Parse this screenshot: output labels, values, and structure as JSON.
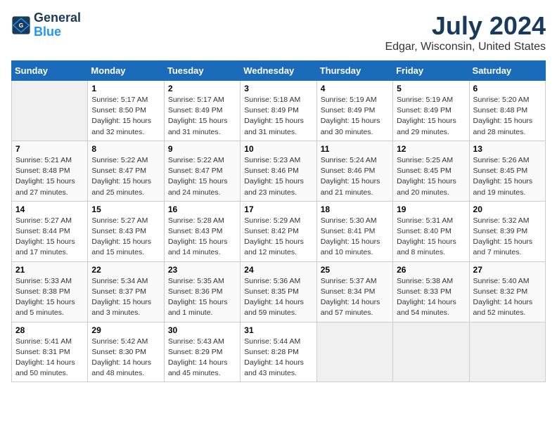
{
  "header": {
    "logo_line1": "General",
    "logo_line2": "Blue",
    "title": "July 2024",
    "subtitle": "Edgar, Wisconsin, United States"
  },
  "days_of_week": [
    "Sunday",
    "Monday",
    "Tuesday",
    "Wednesday",
    "Thursday",
    "Friday",
    "Saturday"
  ],
  "weeks": [
    [
      {
        "day": "",
        "info": ""
      },
      {
        "day": "1",
        "info": "Sunrise: 5:17 AM\nSunset: 8:50 PM\nDaylight: 15 hours\nand 32 minutes."
      },
      {
        "day": "2",
        "info": "Sunrise: 5:17 AM\nSunset: 8:49 PM\nDaylight: 15 hours\nand 31 minutes."
      },
      {
        "day": "3",
        "info": "Sunrise: 5:18 AM\nSunset: 8:49 PM\nDaylight: 15 hours\nand 31 minutes."
      },
      {
        "day": "4",
        "info": "Sunrise: 5:19 AM\nSunset: 8:49 PM\nDaylight: 15 hours\nand 30 minutes."
      },
      {
        "day": "5",
        "info": "Sunrise: 5:19 AM\nSunset: 8:49 PM\nDaylight: 15 hours\nand 29 minutes."
      },
      {
        "day": "6",
        "info": "Sunrise: 5:20 AM\nSunset: 8:48 PM\nDaylight: 15 hours\nand 28 minutes."
      }
    ],
    [
      {
        "day": "7",
        "info": "Sunrise: 5:21 AM\nSunset: 8:48 PM\nDaylight: 15 hours\nand 27 minutes."
      },
      {
        "day": "8",
        "info": "Sunrise: 5:22 AM\nSunset: 8:47 PM\nDaylight: 15 hours\nand 25 minutes."
      },
      {
        "day": "9",
        "info": "Sunrise: 5:22 AM\nSunset: 8:47 PM\nDaylight: 15 hours\nand 24 minutes."
      },
      {
        "day": "10",
        "info": "Sunrise: 5:23 AM\nSunset: 8:46 PM\nDaylight: 15 hours\nand 23 minutes."
      },
      {
        "day": "11",
        "info": "Sunrise: 5:24 AM\nSunset: 8:46 PM\nDaylight: 15 hours\nand 21 minutes."
      },
      {
        "day": "12",
        "info": "Sunrise: 5:25 AM\nSunset: 8:45 PM\nDaylight: 15 hours\nand 20 minutes."
      },
      {
        "day": "13",
        "info": "Sunrise: 5:26 AM\nSunset: 8:45 PM\nDaylight: 15 hours\nand 19 minutes."
      }
    ],
    [
      {
        "day": "14",
        "info": "Sunrise: 5:27 AM\nSunset: 8:44 PM\nDaylight: 15 hours\nand 17 minutes."
      },
      {
        "day": "15",
        "info": "Sunrise: 5:27 AM\nSunset: 8:43 PM\nDaylight: 15 hours\nand 15 minutes."
      },
      {
        "day": "16",
        "info": "Sunrise: 5:28 AM\nSunset: 8:43 PM\nDaylight: 15 hours\nand 14 minutes."
      },
      {
        "day": "17",
        "info": "Sunrise: 5:29 AM\nSunset: 8:42 PM\nDaylight: 15 hours\nand 12 minutes."
      },
      {
        "day": "18",
        "info": "Sunrise: 5:30 AM\nSunset: 8:41 PM\nDaylight: 15 hours\nand 10 minutes."
      },
      {
        "day": "19",
        "info": "Sunrise: 5:31 AM\nSunset: 8:40 PM\nDaylight: 15 hours\nand 8 minutes."
      },
      {
        "day": "20",
        "info": "Sunrise: 5:32 AM\nSunset: 8:39 PM\nDaylight: 15 hours\nand 7 minutes."
      }
    ],
    [
      {
        "day": "21",
        "info": "Sunrise: 5:33 AM\nSunset: 8:38 PM\nDaylight: 15 hours\nand 5 minutes."
      },
      {
        "day": "22",
        "info": "Sunrise: 5:34 AM\nSunset: 8:37 PM\nDaylight: 15 hours\nand 3 minutes."
      },
      {
        "day": "23",
        "info": "Sunrise: 5:35 AM\nSunset: 8:36 PM\nDaylight: 15 hours\nand 1 minute."
      },
      {
        "day": "24",
        "info": "Sunrise: 5:36 AM\nSunset: 8:35 PM\nDaylight: 14 hours\nand 59 minutes."
      },
      {
        "day": "25",
        "info": "Sunrise: 5:37 AM\nSunset: 8:34 PM\nDaylight: 14 hours\nand 57 minutes."
      },
      {
        "day": "26",
        "info": "Sunrise: 5:38 AM\nSunset: 8:33 PM\nDaylight: 14 hours\nand 54 minutes."
      },
      {
        "day": "27",
        "info": "Sunrise: 5:40 AM\nSunset: 8:32 PM\nDaylight: 14 hours\nand 52 minutes."
      }
    ],
    [
      {
        "day": "28",
        "info": "Sunrise: 5:41 AM\nSunset: 8:31 PM\nDaylight: 14 hours\nand 50 minutes."
      },
      {
        "day": "29",
        "info": "Sunrise: 5:42 AM\nSunset: 8:30 PM\nDaylight: 14 hours\nand 48 minutes."
      },
      {
        "day": "30",
        "info": "Sunrise: 5:43 AM\nSunset: 8:29 PM\nDaylight: 14 hours\nand 45 minutes."
      },
      {
        "day": "31",
        "info": "Sunrise: 5:44 AM\nSunset: 8:28 PM\nDaylight: 14 hours\nand 43 minutes."
      },
      {
        "day": "",
        "info": ""
      },
      {
        "day": "",
        "info": ""
      },
      {
        "day": "",
        "info": ""
      }
    ]
  ]
}
